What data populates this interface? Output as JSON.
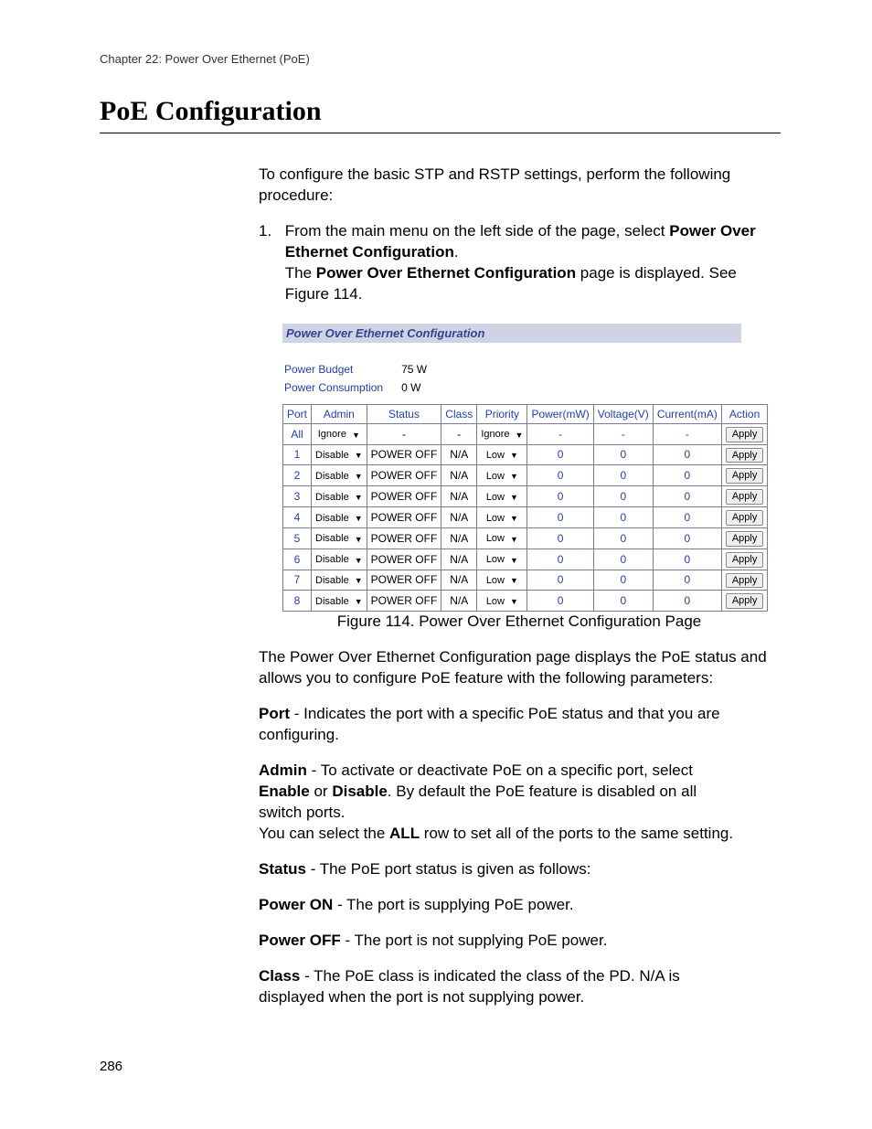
{
  "header": "Chapter 22: Power Over Ethernet (PoE)",
  "page_number": "286",
  "title": "PoE Configuration",
  "intro": "To configure the basic STP and RSTP settings, perform the following procedure:",
  "step1_a": "From the main menu on the left side of the page, select ",
  "step1_bold": "Power Over Ethernet Configuration",
  "step1_b": ".",
  "step1_c1": "The ",
  "step1_c_bold": "Power Over Ethernet Configuration",
  "step1_c2": " page is displayed. See Figure 114.",
  "widget": {
    "title": "Power Over Ethernet Configuration",
    "budget_label": "Power Budget",
    "budget_value": "75 W",
    "consumption_label": "Power Consumption",
    "consumption_value": "0 W",
    "cols": {
      "port": "Port",
      "admin": "Admin",
      "status": "Status",
      "class": "Class",
      "priority": "Priority",
      "power": "Power(mW)",
      "voltage": "Voltage(V)",
      "current": "Current(mA)",
      "action": "Action"
    },
    "apply_label": "Apply",
    "rows": [
      {
        "port": "All",
        "admin": "Ignore",
        "status": "-",
        "class": "-",
        "priority": "Ignore",
        "power": "-",
        "voltage": "-",
        "current": "-"
      },
      {
        "port": "1",
        "admin": "Disable",
        "status": "POWER OFF",
        "class": "N/A",
        "priority": "Low",
        "power": "0",
        "voltage": "0",
        "current": "0"
      },
      {
        "port": "2",
        "admin": "Disable",
        "status": "POWER OFF",
        "class": "N/A",
        "priority": "Low",
        "power": "0",
        "voltage": "0",
        "current": "0"
      },
      {
        "port": "3",
        "admin": "Disable",
        "status": "POWER OFF",
        "class": "N/A",
        "priority": "Low",
        "power": "0",
        "voltage": "0",
        "current": "0"
      },
      {
        "port": "4",
        "admin": "Disable",
        "status": "POWER OFF",
        "class": "N/A",
        "priority": "Low",
        "power": "0",
        "voltage": "0",
        "current": "0"
      },
      {
        "port": "5",
        "admin": "Disable",
        "status": "POWER OFF",
        "class": "N/A",
        "priority": "Low",
        "power": "0",
        "voltage": "0",
        "current": "0"
      },
      {
        "port": "6",
        "admin": "Disable",
        "status": "POWER OFF",
        "class": "N/A",
        "priority": "Low",
        "power": "0",
        "voltage": "0",
        "current": "0"
      },
      {
        "port": "7",
        "admin": "Disable",
        "status": "POWER OFF",
        "class": "N/A",
        "priority": "Low",
        "power": "0",
        "voltage": "0",
        "current": "0"
      },
      {
        "port": "8",
        "admin": "Disable",
        "status": "POWER OFF",
        "class": "N/A",
        "priority": "Low",
        "power": "0",
        "voltage": "0",
        "current": "0"
      }
    ]
  },
  "fig_caption": "Figure 114. Power Over Ethernet Configuration Page",
  "after_fig": "The Power Over Ethernet Configuration page displays the PoE status and allows you to configure PoE feature with the following parameters:",
  "defs": {
    "port_b": "Port",
    "port_t": " - Indicates the port with a specific PoE status and that you are configuring.",
    "admin_b": "Admin",
    "admin_t1": " - To activate or deactivate PoE on a specific port, select ",
    "enable": "Enable",
    "or": " or ",
    "disable": "Disable",
    "admin_t2": ". By default the PoE feature is disabled on all switch ports.",
    "admin_t3a": "You can select the ",
    "all": "ALL",
    "admin_t3b": " row to set all of the ports to the same setting.",
    "status_b": "Status",
    "status_t": " - The PoE port status is given as follows:",
    "pon_b": "Power ON",
    "pon_t": " - The port is supplying PoE power.",
    "poff_b": "Power OFF",
    "poff_t": " - The port is not supplying PoE power.",
    "class_b": "Class",
    "class_t": " - The PoE class is indicated the class of the PD. N/A is displayed when the port is not supplying power."
  }
}
